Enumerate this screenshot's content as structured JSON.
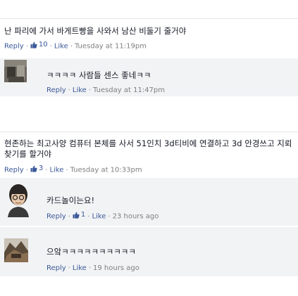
{
  "thread1": {
    "comment": {
      "text": "난 파리에 가서 바게트빵을 사와서 남산 비둘기 줄거야",
      "reply_label": "Reply",
      "likes": "10",
      "like_label": "Like",
      "time": "Tuesday at 11:19pm"
    },
    "reply": {
      "text": "ㅋㅋㅋㅋ 사람들 센스 좋네ㅋㅋ",
      "reply_label": "Reply",
      "like_label": "Like",
      "time": "Tuesday at 11:47pm"
    }
  },
  "thread2": {
    "comment": {
      "text": "현존하는 최고사양 컴퓨터 본체를 사서 51인치 3d티비에 연결하고 3d 안경쓰고 지뢰 찾기를 할거야",
      "reply_label": "Reply",
      "likes": "3",
      "like_label": "Like",
      "time": "Tuesday at 10:33pm"
    },
    "replies": [
      {
        "text": "카드놀이는요!",
        "reply_label": "Reply",
        "likes": "1",
        "like_label": "Like",
        "time": "23 hours ago"
      },
      {
        "text": "으앜ㅋㅋㅋㅋㅋㅋㅋㅋㅋㅋ",
        "reply_label": "Reply",
        "like_label": "Like",
        "time": "19 hours ago"
      }
    ]
  },
  "colors": {
    "link": "#3b5998",
    "meta": "#7f7f7f",
    "reply_bg": "#f2f3f5"
  },
  "icons": {
    "like": "thumbs-up-icon"
  }
}
